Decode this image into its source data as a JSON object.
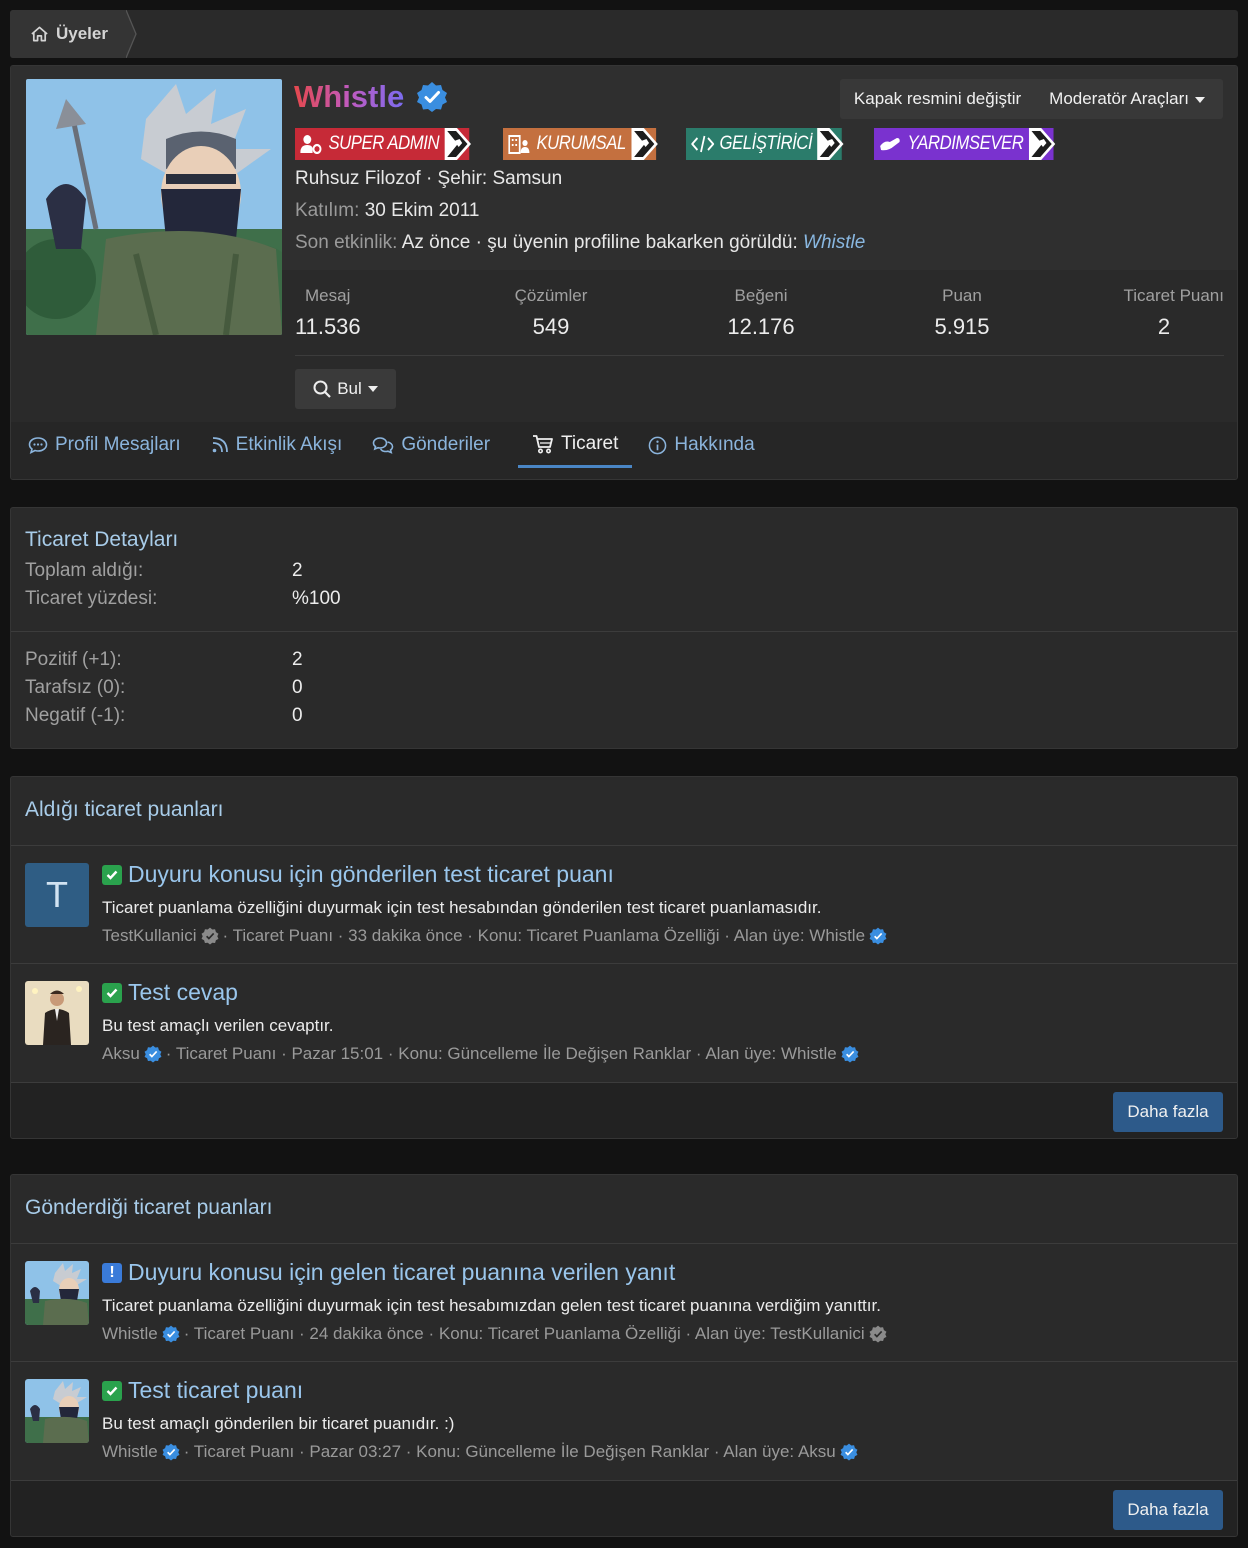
{
  "breadcrumb": {
    "label": "Üyeler"
  },
  "profile": {
    "username": "Whistle",
    "buttons": {
      "cover": "Kapak resmini değiştir",
      "moderator": "Moderatör Araçları"
    },
    "banners": [
      {
        "label": "SUPER ADMIN",
        "color": "#c82b35"
      },
      {
        "label": "KURUMSAL",
        "color": "#c9703f"
      },
      {
        "label": "GELİŞTİRİCİ",
        "color": "#2c7d6c"
      },
      {
        "label": "YARDIMSEVER",
        "color": "#7a33d0"
      }
    ],
    "title_line": "Ruhsuz Filozof · Şehir: Samsun",
    "joined_label": "Katılım:",
    "joined_value": "30 Ekim 2011",
    "activity_label": "Son etkinlik:",
    "activity_value": "Az önce · şu üyenin profiline bakarken görüldü:",
    "activity_link": "Whistle",
    "stats": [
      {
        "label": "Mesaj",
        "value": "11.536"
      },
      {
        "label": "Çözümler",
        "value": "549"
      },
      {
        "label": "Beğeni",
        "value": "12.176"
      },
      {
        "label": "Puan",
        "value": "5.915"
      },
      {
        "label": "Ticaret Puanı",
        "value": "2"
      }
    ],
    "find_button": "Bul"
  },
  "tabs": [
    {
      "label": "Profil Mesajları",
      "icon": "comment-icon"
    },
    {
      "label": "Etkinlik Akışı",
      "icon": "rss-icon"
    },
    {
      "label": "Gönderiler",
      "icon": "comments-icon"
    },
    {
      "label": "Ticaret",
      "icon": "cart-icon",
      "active": true
    },
    {
      "label": "Hakkında",
      "icon": "info-icon"
    }
  ],
  "trade_details": {
    "title": "Ticaret Detayları",
    "rows": [
      {
        "label": "Toplam aldığı:",
        "value": "2"
      },
      {
        "label": "Ticaret yüzdesi:",
        "value": "%100"
      }
    ],
    "rows2": [
      {
        "label": "Pozitif (+1):",
        "value": "2"
      },
      {
        "label": "Tarafsız (0):",
        "value": "0"
      },
      {
        "label": "Negatif (-1):",
        "value": "0"
      }
    ]
  },
  "received": {
    "title": "Aldığı ticaret puanları",
    "items": [
      {
        "avatar_letter": "T",
        "title": "Duyuru konusu için gönderilen test ticaret puanı",
        "desc": "Ticaret puanlama özelliğini duyurmak için test hesabından gönderilen test ticaret puanlamasıdır.",
        "author": "TestKullanici",
        "meta": "· Ticaret Puanı · 33 dakika önce · Konu: Ticaret Puanlama Özelliği · Alan üye: Whistle"
      },
      {
        "title": "Test cevap",
        "desc": "Bu test amaçlı verilen cevaptır.",
        "author": "Aksu",
        "meta": "· Ticaret Puanı · Pazar 15:01 · Konu: Güncelleme İle Değişen Ranklar · Alan üye: Whistle"
      }
    ],
    "more": "Daha fazla"
  },
  "sent": {
    "title": "Gönderdiği ticaret puanları",
    "items": [
      {
        "title": "Duyuru konusu için gelen ticaret puanına verilen yanıt",
        "desc": "Ticaret puanlama özelliğini duyurmak için test hesabımızdan gelen test ticaret puanına verdiğim yanıttır.",
        "author": "Whistle",
        "meta": "· Ticaret Puanı · 24 dakika önce · Konu: Ticaret Puanlama Özelliği · Alan üye: TestKullanici"
      },
      {
        "title": "Test ticaret puanı",
        "desc": "Bu test amaçlı gönderilen bir ticaret puanıdır. :)",
        "author": "Whistle",
        "meta": "· Ticaret Puanı · Pazar 03:27 · Konu: Güncelleme İle Değişen Ranklar · Alan üye: Aksu"
      }
    ],
    "more": "Daha fazla"
  }
}
